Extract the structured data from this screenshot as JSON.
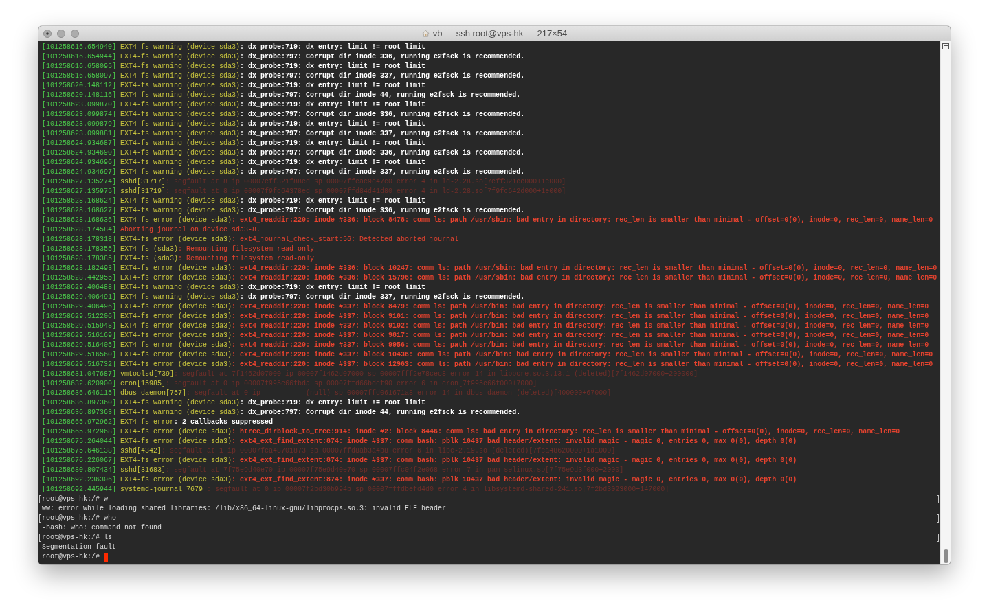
{
  "window": {
    "title": "vb — ssh root@vps-hk — 217×54"
  },
  "terminal": {
    "lines": [
      {
        "kind": "warning",
        "timestamp": "[101258616.654940]",
        "source": "EXT4-fs warning (device sda3)",
        "message": ": dx_probe:719: dx entry: limit != root limit"
      },
      {
        "kind": "warning",
        "timestamp": "[101258616.654944]",
        "source": "EXT4-fs warning (device sda3)",
        "message": ": dx_probe:797: Corrupt dir inode 336, running e2fsck is recommended."
      },
      {
        "kind": "warning",
        "timestamp": "[101258616.658095]",
        "source": "EXT4-fs warning (device sda3)",
        "message": ": dx_probe:719: dx entry: limit != root limit"
      },
      {
        "kind": "warning",
        "timestamp": "[101258616.658097]",
        "source": "EXT4-fs warning (device sda3)",
        "message": ": dx_probe:797: Corrupt dir inode 337, running e2fsck is recommended."
      },
      {
        "kind": "warning",
        "timestamp": "[101258620.148112]",
        "source": "EXT4-fs warning (device sda3)",
        "message": ": dx_probe:719: dx entry: limit != root limit"
      },
      {
        "kind": "warning",
        "timestamp": "[101258620.148116]",
        "source": "EXT4-fs warning (device sda3)",
        "message": ": dx_probe:797: Corrupt dir inode 44, running e2fsck is recommended."
      },
      {
        "kind": "warning",
        "timestamp": "[101258623.099870]",
        "source": "EXT4-fs warning (device sda3)",
        "message": ": dx_probe:719: dx entry: limit != root limit"
      },
      {
        "kind": "warning",
        "timestamp": "[101258623.099874]",
        "source": "EXT4-fs warning (device sda3)",
        "message": ": dx_probe:797: Corrupt dir inode 336, running e2fsck is recommended."
      },
      {
        "kind": "warning",
        "timestamp": "[101258623.099879]",
        "source": "EXT4-fs warning (device sda3)",
        "message": ": dx_probe:719: dx entry: limit != root limit"
      },
      {
        "kind": "warning",
        "timestamp": "[101258623.099881]",
        "source": "EXT4-fs warning (device sda3)",
        "message": ": dx_probe:797: Corrupt dir inode 337, running e2fsck is recommended."
      },
      {
        "kind": "warning",
        "timestamp": "[101258624.934687]",
        "source": "EXT4-fs warning (device sda3)",
        "message": ": dx_probe:719: dx entry: limit != root limit"
      },
      {
        "kind": "warning",
        "timestamp": "[101258624.934690]",
        "source": "EXT4-fs warning (device sda3)",
        "message": ": dx_probe:797: Corrupt dir inode 336, running e2fsck is recommended."
      },
      {
        "kind": "warning",
        "timestamp": "[101258624.934696]",
        "source": "EXT4-fs warning (device sda3)",
        "message": ": dx_probe:719: dx entry: limit != root limit"
      },
      {
        "kind": "warning",
        "timestamp": "[101258624.934697]",
        "source": "EXT4-fs warning (device sda3)",
        "message": ": dx_probe:797: Corrupt dir inode 337, running e2fsck is recommended."
      },
      {
        "kind": "info",
        "timestamp": "[101258627.135274]",
        "source": "sshd[31717]",
        "message": ": segfault at 8 ip 00007eff321f88ed sp 00007ffeac9c47c0 error 4 in ld-2.28.so[7eff321ee000+1e000]"
      },
      {
        "kind": "info",
        "timestamp": "[101258627.135975]",
        "source": "sshd[31719]",
        "message": ": segfault at 8 ip 00007f9fc64378ed sp 00007ffd84d41d80 error 4 in ld-2.28.so[7f9fc642d000+1e000]"
      },
      {
        "kind": "warning",
        "timestamp": "[101258628.168624]",
        "source": "EXT4-fs warning (device sda3)",
        "message": ": dx_probe:719: dx entry: limit != root limit"
      },
      {
        "kind": "warning",
        "timestamp": "[101258628.168627]",
        "source": "EXT4-fs warning (device sda3)",
        "message": ": dx_probe:797: Corrupt dir inode 336, running e2fsck is recommended."
      },
      {
        "kind": "critical",
        "timestamp": "[101258628.168636]",
        "source": "EXT4-fs error (device sda3)",
        "message": ": ext4_readdir:220: inode #336: block 8478: comm ls: path /usr/sbin: bad entry in directory: rec_len is smaller than minimal - offset=0(0), inode=0, rec_len=0, name_len=0"
      },
      {
        "kind": "error",
        "timestamp": "[101258628.174584]",
        "message": "Aborting journal on device sda3-8."
      },
      {
        "kind": "error",
        "timestamp": "[101258628.178318]",
        "source": "EXT4-fs error (device sda3)",
        "message": ": ext4_journal_check_start:56: Detected aborted journal"
      },
      {
        "kind": "error",
        "timestamp": "[101258628.178355]",
        "source": "EXT4-fs (sda3)",
        "message": ": Remounting filesystem read-only"
      },
      {
        "kind": "error",
        "timestamp": "[101258628.178385]",
        "source": "EXT4-fs (sda3)",
        "message": ": Remounting filesystem read-only"
      },
      {
        "kind": "critical",
        "timestamp": "[101258628.182493]",
        "source": "EXT4-fs error (device sda3)",
        "message": ": ext4_readdir:220: inode #336: block 10247: comm ls: path /usr/sbin: bad entry in directory: rec_len is smaller than minimal - offset=0(0), inode=0, rec_len=0, name_len=0"
      },
      {
        "kind": "critical",
        "timestamp": "[101258628.442955]",
        "source": "EXT4-fs error (device sda3)",
        "message": ": ext4_readdir:220: inode #336: block 15796: comm ls: path /usr/sbin: bad entry in directory: rec_len is smaller than minimal - offset=0(0), inode=0, rec_len=0, name_len=0"
      },
      {
        "kind": "warning",
        "timestamp": "[101258629.406488]",
        "source": "EXT4-fs warning (device sda3)",
        "message": ": dx_probe:719: dx entry: limit != root limit"
      },
      {
        "kind": "warning",
        "timestamp": "[101258629.406491]",
        "source": "EXT4-fs warning (device sda3)",
        "message": ": dx_probe:797: Corrupt dir inode 337, running e2fsck is recommended."
      },
      {
        "kind": "critical",
        "timestamp": "[101258629.406496]",
        "source": "EXT4-fs error (device sda3)",
        "message": ": ext4_readdir:220: inode #337: block 8479: comm ls: path /usr/bin: bad entry in directory: rec_len is smaller than minimal - offset=0(0), inode=0, rec_len=0, name_len=0"
      },
      {
        "kind": "critical",
        "timestamp": "[101258629.512206]",
        "source": "EXT4-fs error (device sda3)",
        "message": ": ext4_readdir:220: inode #337: block 9101: comm ls: path /usr/bin: bad entry in directory: rec_len is smaller than minimal - offset=0(0), inode=0, rec_len=0, name_len=0"
      },
      {
        "kind": "critical",
        "timestamp": "[101258629.515948]",
        "source": "EXT4-fs error (device sda3)",
        "message": ": ext4_readdir:220: inode #337: block 9102: comm ls: path /usr/bin: bad entry in directory: rec_len is smaller than minimal - offset=0(0), inode=0, rec_len=0, name_len=0"
      },
      {
        "kind": "critical",
        "timestamp": "[101258629.516169]",
        "source": "EXT4-fs error (device sda3)",
        "message": ": ext4_readdir:220: inode #337: block 9817: comm ls: path /usr/bin: bad entry in directory: rec_len is smaller than minimal - offset=0(0), inode=0, rec_len=0, name_len=0"
      },
      {
        "kind": "critical",
        "timestamp": "[101258629.516405]",
        "source": "EXT4-fs error (device sda3)",
        "message": ": ext4_readdir:220: inode #337: block 9956: comm ls: path /usr/bin: bad entry in directory: rec_len is smaller than minimal - offset=0(0), inode=0, rec_len=0, name_len=0"
      },
      {
        "kind": "critical",
        "timestamp": "[101258629.516560]",
        "source": "EXT4-fs error (device sda3)",
        "message": ": ext4_readdir:220: inode #337: block 10436: comm ls: path /usr/bin: bad entry in directory: rec_len is smaller than minimal - offset=0(0), inode=0, rec_len=0, name_len=0"
      },
      {
        "kind": "critical",
        "timestamp": "[101258629.516732]",
        "source": "EXT4-fs error (device sda3)",
        "message": ": ext4_readdir:220: inode #337: block 12963: comm ls: path /usr/bin: bad entry in directory: rec_len is smaller than minimal - offset=0(0), inode=0, rec_len=0, name_len=0"
      },
      {
        "kind": "info",
        "timestamp": "[101258631.047687]",
        "source": "vmtoolsd[739]",
        "message": ": segfault at 7f1462d07000 ip 00007f1462d07000 sp 00007fff2e78cec8 error 14 in libpcre.so.3.13.1 (deleted)[7f1462d07000+200000]"
      },
      {
        "kind": "info",
        "timestamp": "[101258632.620900]",
        "source": "cron[15985]",
        "message": ": segfault at 0 ip 00007f995e66fbda sp 00007ffd66bdef90 error 6 in cron[7f995e66f000+7000]"
      },
      {
        "kind": "info",
        "timestamp": "[101258636.646115]",
        "source": "dbus-daemon[757]",
        "message": ": segfault at 0 ip           (null) sp 00007ffd061671a8 error 14 in dbus-daemon (deleted)[400000+67000]"
      },
      {
        "kind": "warning",
        "timestamp": "[101258636.897360]",
        "source": "EXT4-fs warning (device sda3)",
        "message": ": dx_probe:719: dx entry: limit != root limit"
      },
      {
        "kind": "warning",
        "timestamp": "[101258636.897363]",
        "source": "EXT4-fs warning (device sda3)",
        "message": ": dx_probe:797: Corrupt dir inode 44, running e2fsck is recommended."
      },
      {
        "kind": "warning",
        "timestamp": "[101258665.972962]",
        "source": "EXT4-fs error",
        "message": ": 2 callbacks suppressed"
      },
      {
        "kind": "critical",
        "timestamp": "[101258665.972968]",
        "source": "EXT4-fs error (device sda3)",
        "message": ": htree_dirblock_to_tree:914: inode #2: block 8446: comm ls: bad entry in directory: rec_len is smaller than minimal - offset=0(0), inode=0, rec_len=0, name_len=0"
      },
      {
        "kind": "critical",
        "timestamp": "[101258675.264044]",
        "source": "EXT4-fs error (device sda3)",
        "message": ": ext4_ext_find_extent:874: inode #337: comm bash: pblk 10437 bad header/extent: invalid magic - magic 0, entries 0, max 0(0), depth 0(0)"
      },
      {
        "kind": "info",
        "timestamp": "[101258675.646138]",
        "source": "sshd[4342]",
        "message": ": segfault at 1 ip 00007fca48701873 sp 00007ffd8ab3a4b8 error 6 in libc-2.19.so (deleted)[7fca48620000+1a1000]"
      },
      {
        "kind": "critical",
        "timestamp": "[101258676.226067]",
        "source": "EXT4-fs error (device sda3)",
        "message": ": ext4_ext_find_extent:874: inode #337: comm bash: pblk 10437 bad header/extent: invalid magic - magic 0, entries 0, max 0(0), depth 0(0)"
      },
      {
        "kind": "info",
        "timestamp": "[101258680.807434]",
        "source": "sshd[31683]",
        "message": ": segfault at 7f75e9d40e70 ip 00007f75e9d40e70 sp 00007ffc04f2e068 error 7 in pam_selinux.so[7f75e9d3f000+2000]"
      },
      {
        "kind": "critical",
        "timestamp": "[101258692.236306]",
        "source": "EXT4-fs error (device sda3)",
        "message": ": ext4_ext_find_extent:874: inode #337: comm bash: pblk 10437 bad header/extent: invalid magic - magic 0, entries 0, max 0(0), depth 0(0)"
      },
      {
        "kind": "info",
        "timestamp": "[101258692.445944]",
        "source": "systemd-journal[7679]",
        "message": ": segfault at 0 ip 00007f2bd30b994b sp 00007fffdbefd4d0 error 4 in libsystemd-shared-241.so[7f2bd3023000+147000]"
      },
      {
        "kind": "prompt",
        "text": "root@vps-hk:/# w",
        "marked": true,
        "cursor": false
      },
      {
        "kind": "output",
        "text": "ww: error while loading shared libraries: /lib/x86_64-linux-gnu/libprocps.so.3: invalid ELF header"
      },
      {
        "kind": "prompt",
        "text": "root@vps-hk:/# who",
        "marked": true,
        "cursor": false
      },
      {
        "kind": "output",
        "text": "-bash: who: command not found"
      },
      {
        "kind": "prompt",
        "text": "root@vps-hk:/# ls",
        "marked": true,
        "cursor": false
      },
      {
        "kind": "output",
        "text": "Segmentation fault"
      },
      {
        "kind": "prompt",
        "text": "root@vps-hk:/#",
        "marked": false,
        "cursor": true
      }
    ]
  }
}
